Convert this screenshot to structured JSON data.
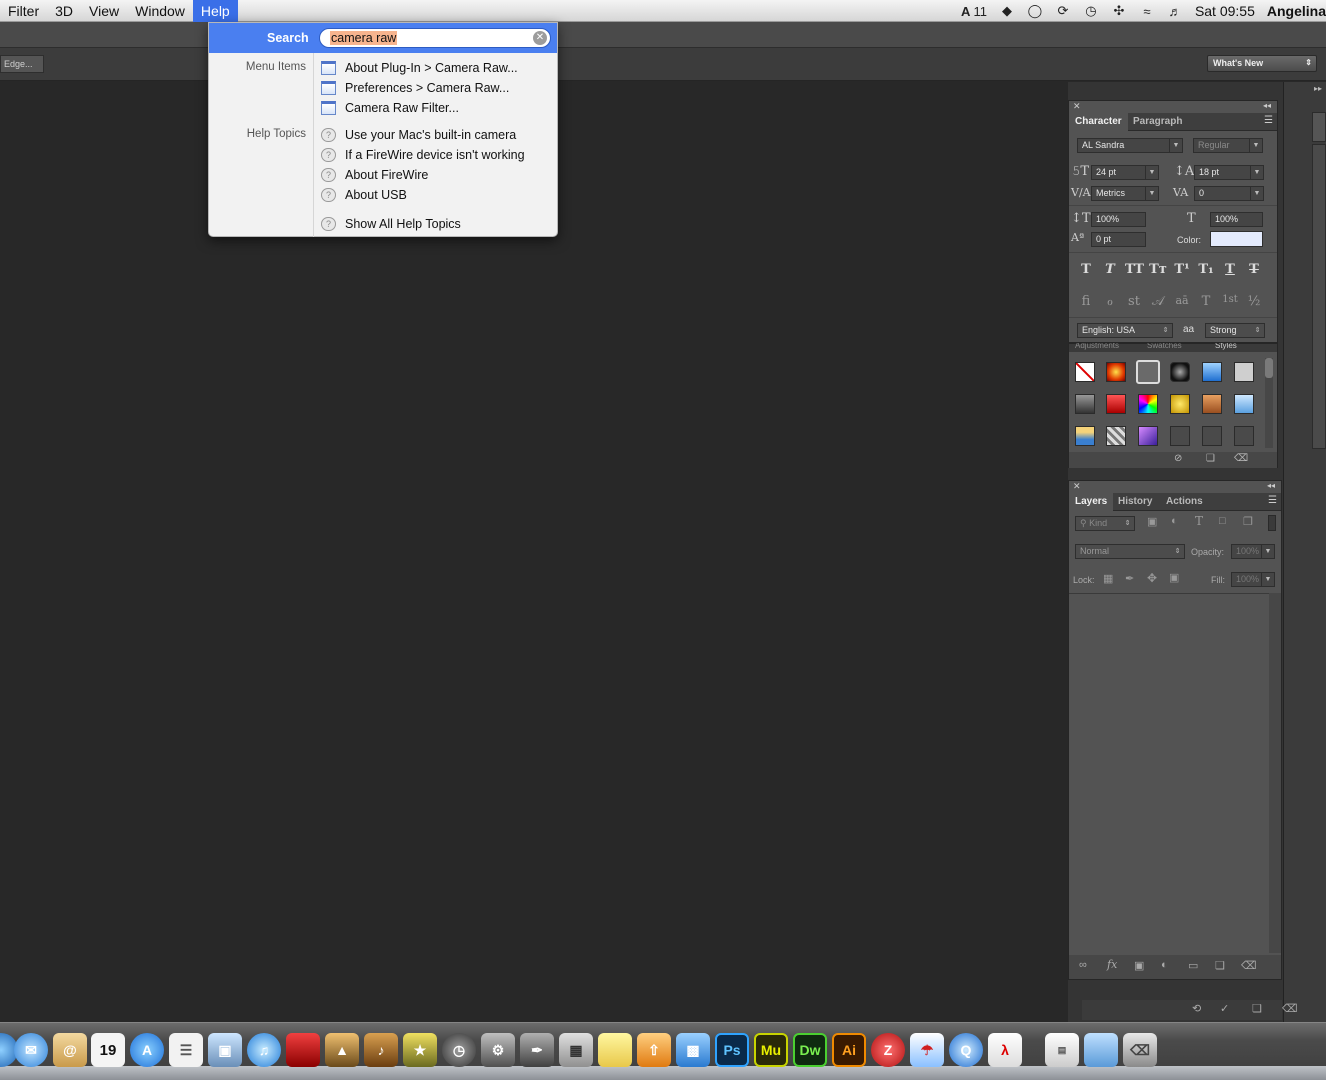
{
  "menubar": {
    "items": [
      "Filter",
      "3D",
      "View",
      "Window",
      "Help"
    ],
    "active": "Help",
    "status": {
      "ai_count": "11",
      "clock": "Sat 09:55",
      "user": "Angelina"
    }
  },
  "options_bar": {
    "edge_button": "Edge...",
    "workspace": "What's New"
  },
  "help_menu": {
    "search_label": "Search",
    "search_value": "camera raw",
    "menu_items_label": "Menu Items",
    "menu_items": [
      "About Plug-In > Camera Raw...",
      "Preferences > Camera Raw...",
      "Camera Raw Filter..."
    ],
    "help_topics_label": "Help Topics",
    "help_topics": [
      "Use your Mac's built-in camera",
      "If a FireWire device isn't working",
      "About FireWire",
      "About USB"
    ],
    "show_all": "Show All Help Topics"
  },
  "character_panel": {
    "tabs": [
      "Character",
      "Paragraph"
    ],
    "font_family": "AL Sandra",
    "font_style": "Regular",
    "font_size": "24 pt",
    "leading": "18 pt",
    "kerning": "Metrics",
    "tracking": "0",
    "vertical_scale": "100%",
    "horizontal_scale": "100%",
    "baseline_shift": "0 pt",
    "color_label": "Color:",
    "color_value": "#e3eafc",
    "type_buttons": [
      "T",
      "T",
      "TT",
      "Tт",
      "T¹",
      "T₁",
      "T",
      "T"
    ],
    "opentype_buttons": [
      "fi",
      "ℴ",
      "st",
      "𝒜",
      "aā",
      "T",
      "1st",
      "½"
    ],
    "language": "English: USA",
    "antialias_icon": "aa",
    "antialias": "Strong"
  },
  "styles_panel": {
    "tabs": [
      "Adjustments",
      "Swatches",
      "Styles"
    ]
  },
  "layers_panel": {
    "tabs": [
      "Layers",
      "History",
      "Actions"
    ],
    "filter": "Kind",
    "blend_mode": "Normal",
    "opacity_label": "Opacity:",
    "opacity": "100%",
    "lock_label": "Lock:",
    "fill_label": "Fill:",
    "fill": "100%"
  },
  "dock": {
    "calendar_day": "19",
    "apps": [
      "Ps",
      "Mu",
      "Dw",
      "Ai"
    ]
  }
}
